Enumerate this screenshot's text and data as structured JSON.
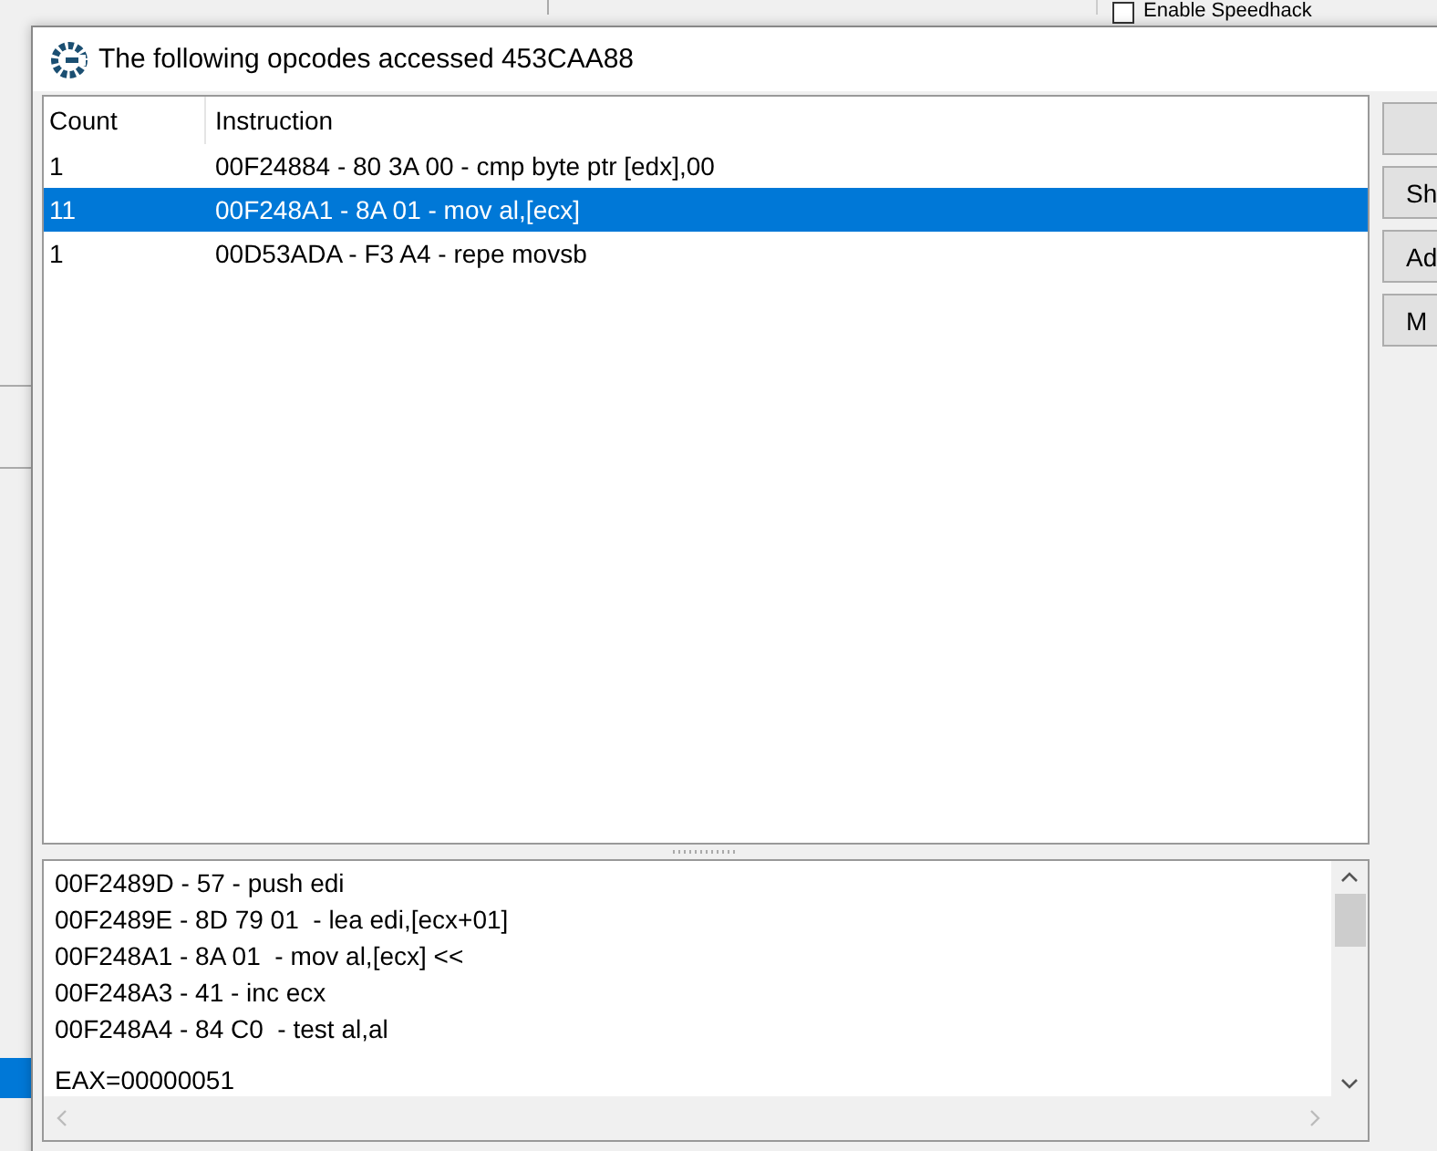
{
  "background_window": {
    "checkbox": {
      "label": "Enable Speedhack",
      "checked": false
    }
  },
  "dialog": {
    "title": "The following opcodes accessed 453CAA88"
  },
  "table": {
    "columns": [
      "Count",
      "Instruction"
    ],
    "rows": [
      {
        "count": "1",
        "instruction": "00F24884 - 80 3A 00 - cmp byte ptr [edx],00",
        "selected": false
      },
      {
        "count": "11",
        "instruction": "00F248A1 - 8A 01  - mov al,[ecx]",
        "selected": true
      },
      {
        "count": "1",
        "instruction": "00D53ADA - F3 A4 - repe movsb",
        "selected": false
      }
    ]
  },
  "side_buttons": [
    "Sh",
    "Ad",
    "M"
  ],
  "disassembly": {
    "lines": [
      "00F2489D - 57 - push edi",
      "00F2489E - 8D 79 01  - lea edi,[ecx+01]",
      "00F248A1 - 8A 01  - mov al,[ecx] <<",
      "00F248A3 - 41 - inc ecx",
      "00F248A4 - 84 C0  - test al,al"
    ],
    "registers": [
      "EAX=00000051"
    ]
  }
}
